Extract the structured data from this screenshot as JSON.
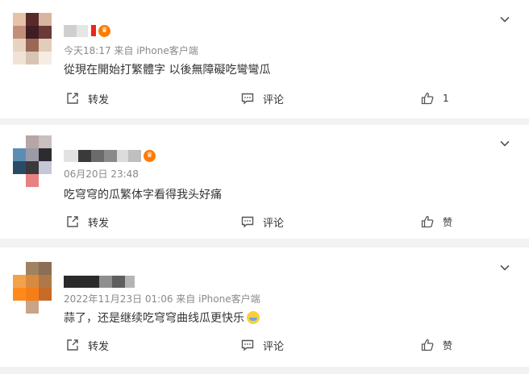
{
  "comments": [
    {
      "meta": "今天18:17  来自 iPhone客户端",
      "content": "從現在開始打繁體字 以後無障礙吃彎彎瓜",
      "share_label": "转发",
      "comment_label": "评论",
      "like_label": "1",
      "avatar_colors": [
        "#e4c3a8",
        "#5a2a2a",
        "#d9b5a0",
        "#c48f7a",
        "#3e1e22",
        "#6b3a38",
        "#e8d3c2",
        "#9c6856",
        "#e2cdb9",
        "#f0e3d6",
        "#d8c4b2",
        "#f5ece3"
      ],
      "name_blocks": [
        "#cfcfcf",
        "#e6e6e6"
      ],
      "badge": "vip"
    },
    {
      "meta": "06月20日 23:48",
      "content": "吃穹穹的瓜繁体字看得我头好痛",
      "share_label": "转发",
      "comment_label": "评论",
      "like_label": "赞",
      "avatar_colors": [
        "#ffffff",
        "#b8a6a6",
        "#c9bfbf",
        "#5b8db3",
        "#9c9aa8",
        "#2c2c30",
        "#2b4a66",
        "#3a3a3a",
        "#c5c7d6",
        "#ffffff",
        "#e88282",
        "#ffffff"
      ],
      "name_blocks": [
        "#e2e2e2",
        "#3a3a3a",
        "#6b6b6b",
        "#8a8a8a",
        "#dcdcdc",
        "#bfbfbf"
      ],
      "badge": "vip"
    },
    {
      "meta": "2022年11月23日 01:06  来自 iPhone客户端",
      "content": "蒜了，还是继续吃穹穹曲线瓜更快乐",
      "share_label": "转发",
      "comment_label": "评论",
      "like_label": "赞",
      "avatar_colors": [
        "#ffffff",
        "#a08262",
        "#8a6e55",
        "#f2a24a",
        "#d98a3e",
        "#b07848",
        "#ff8a1a",
        "#f57e18",
        "#c86a28",
        "#ffffff",
        "#c9a488",
        "#ffffff"
      ],
      "name_blocks": [
        "#2a2a2a",
        "#8e8e8e",
        "#5e5e5e",
        "#b4b4b4"
      ],
      "badge": "none"
    }
  ]
}
